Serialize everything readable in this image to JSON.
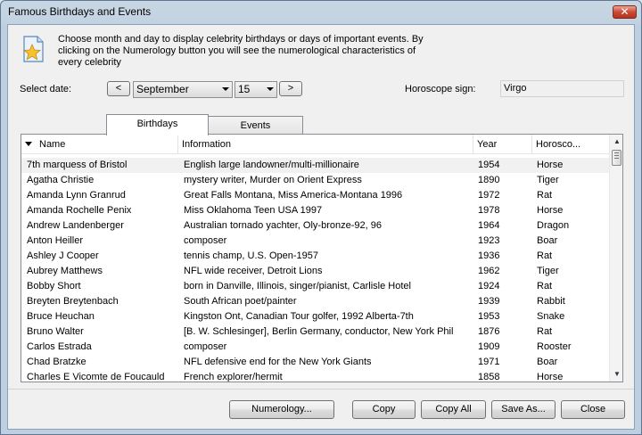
{
  "window": {
    "title": "Famous Birthdays and Events",
    "close_label": "✕"
  },
  "description": "Choose month and day to display celebrity birthdays or days of important events. By clicking on the Numerology button you will see the numerological characteristics of every celebrity",
  "date": {
    "label": "Select date:",
    "prev": "<",
    "next": ">",
    "month": "September",
    "day": "15"
  },
  "horoscope": {
    "label": "Horoscope sign:",
    "value": "Virgo"
  },
  "tabs": [
    {
      "label": "Birthdays"
    },
    {
      "label": "Events"
    }
  ],
  "table": {
    "columns": [
      "Name",
      "Information",
      "Year",
      "Horosco..."
    ],
    "rows": [
      {
        "name": "7th marquess of Bristol",
        "info": "English large landowner/multi-millionaire",
        "year": "1954",
        "sign": "Horse"
      },
      {
        "name": "Agatha Christie",
        "info": "mystery writer, Murder on Orient Express",
        "year": "1890",
        "sign": "Tiger"
      },
      {
        "name": "Amanda Lynn Granrud",
        "info": "Great Falls Montana, Miss America-Montana 1996",
        "year": "1972",
        "sign": "Rat"
      },
      {
        "name": "Amanda Rochelle Penix",
        "info": "Miss Oklahoma Teen USA 1997",
        "year": "1978",
        "sign": "Horse"
      },
      {
        "name": "Andrew Landenberger",
        "info": "Australian tornado yachter, Oly-bronze-92, 96",
        "year": "1964",
        "sign": "Dragon"
      },
      {
        "name": "Anton Heiller",
        "info": "composer",
        "year": "1923",
        "sign": "Boar"
      },
      {
        "name": "Ashley J Cooper",
        "info": "tennis champ, U.S. Open-1957",
        "year": "1936",
        "sign": "Rat"
      },
      {
        "name": "Aubrey Matthews",
        "info": "NFL wide receiver, Detroit Lions",
        "year": "1962",
        "sign": "Tiger"
      },
      {
        "name": "Bobby Short",
        "info": "born in Danville, Illinois, singer/pianist, Carlisle Hotel",
        "year": "1924",
        "sign": "Rat"
      },
      {
        "name": "Breyten Breytenbach",
        "info": "South African poet/painter",
        "year": "1939",
        "sign": "Rabbit"
      },
      {
        "name": "Bruce Heuchan",
        "info": "Kingston Ont, Canadian Tour golfer, 1992 Alberta-7th",
        "year": "1953",
        "sign": "Snake"
      },
      {
        "name": "Bruno Walter",
        "info": "[B. W. Schlesinger], Berlin Germany, conductor, New York Phil",
        "year": "1876",
        "sign": "Rat"
      },
      {
        "name": "Carlos Estrada",
        "info": "composer",
        "year": "1909",
        "sign": "Rooster"
      },
      {
        "name": "Chad Bratzke",
        "info": "NFL defensive end for the New York Giants",
        "year": "1971",
        "sign": "Boar"
      },
      {
        "name": "Charles E Vicomte de Foucauld",
        "info": "French explorer/hermit",
        "year": "1858",
        "sign": "Horse"
      }
    ]
  },
  "buttons": {
    "numerology": "Numerology...",
    "copy": "Copy",
    "copy_all": "Copy All",
    "save_as": "Save As...",
    "close": "Close"
  }
}
